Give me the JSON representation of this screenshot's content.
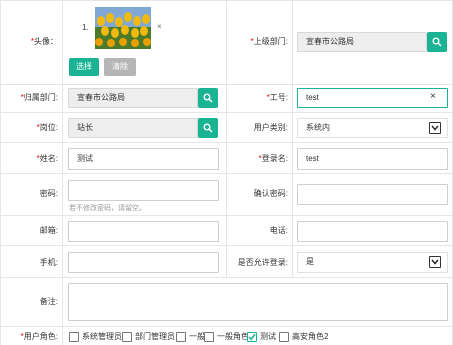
{
  "avatar": {
    "label": "头像：",
    "index": "1.",
    "remove": "×",
    "choose_btn": "选择",
    "clear_btn": "清除"
  },
  "dept": {
    "label": "上级部门:",
    "value": "宣春市公路局"
  },
  "belong_dept": {
    "label": "归属部门:",
    "value": "宣春市公路局"
  },
  "job_no": {
    "label": "工号:",
    "value": "test",
    "clear": "×"
  },
  "post": {
    "label": "岗位:",
    "value": "站长"
  },
  "user_type": {
    "label": "用户类别:",
    "value": "系统内"
  },
  "name": {
    "label": "姓名:",
    "value": "测试"
  },
  "login": {
    "label": "登录名:",
    "value": "test"
  },
  "password": {
    "label": "密码:",
    "value": "",
    "hint": "若不修改密码，请留空。"
  },
  "confirm_password": {
    "label": "确认密码:",
    "value": ""
  },
  "email": {
    "label": "邮箱:",
    "value": ""
  },
  "phone": {
    "label": "电话:",
    "value": ""
  },
  "mobile": {
    "label": "手机:",
    "value": ""
  },
  "allow_login": {
    "label": "是否允许登录:",
    "value": "是"
  },
  "remark": {
    "label": "备注:",
    "value": ""
  },
  "roles": {
    "label": "用户角色:",
    "items": [
      {
        "label": "系统管理员",
        "checked": false
      },
      {
        "label": "部门管理员",
        "checked": false
      },
      {
        "label": "一般",
        "checked": false
      },
      {
        "label": "一般角色",
        "checked": false
      },
      {
        "label": "测试",
        "checked": true
      },
      {
        "label": "高安角色2",
        "checked": false
      }
    ]
  },
  "colors": {
    "accent": "#1ab394",
    "required": "#e00000",
    "readonly_bg": "#eeeeee",
    "clear_btn": "#b5b5b5"
  },
  "icons": {
    "search": "search-icon",
    "clear": "close-icon",
    "select": "chevron-down-icon",
    "check": "check-icon"
  }
}
